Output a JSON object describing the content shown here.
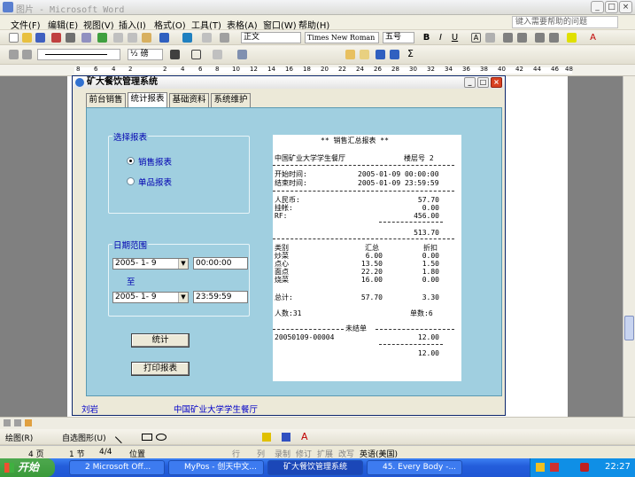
{
  "word": {
    "title": "图片 - Microsoft Word",
    "help_placeholder": "键入需要帮助的问题",
    "menu": [
      "文件(F)",
      "编辑(E)",
      "视图(V)",
      "插入(I)",
      "格式(O)",
      "工具(T)",
      "表格(A)",
      "窗口(W)",
      "帮助(H)"
    ],
    "style_value": "正文",
    "font_value": "Times New Roman",
    "size_value": "五号",
    "zoom_value": "½ 磅"
  },
  "ruler_numbers": [
    "8",
    "6",
    "4",
    "2",
    "",
    "2",
    "4",
    "6",
    "8",
    "10",
    "12",
    "14",
    "16",
    "18",
    "20",
    "22",
    "24",
    "26",
    "28",
    "30",
    "32",
    "34",
    "36",
    "38",
    "40",
    "42",
    "44",
    "46",
    "48"
  ],
  "app": {
    "title": "矿大餐饮管理系统",
    "tabs": [
      "前台销售",
      "统计报表",
      "基础资料",
      "系统维护"
    ],
    "report_group": "选择报表",
    "radio_sales": "销售报表",
    "radio_item": "单品报表",
    "date_group": "日期范围",
    "date_from": "2005- 1- 9",
    "time_from": "00:00:00",
    "to_label": "至",
    "date_to": "2005- 1- 9",
    "time_to": "23:59:59",
    "btn_stats": "统计",
    "btn_print": "打印报表",
    "footer_left": "刘岩",
    "footer_right": "中国矿业大学学生餐厅"
  },
  "report": {
    "title": "** 销售汇总报表 **",
    "restaurant": "中国矿业大学学生餐厅",
    "floor_label": "楼层号 2",
    "start_label": "开始时间:",
    "start_value": "2005-01-09 00:00:00",
    "end_label": "结束时间:",
    "end_value": "2005-01-09 23:59:59",
    "payments": [
      {
        "label": "人民币:",
        "value": "57.70"
      },
      {
        "label": "挂帐:",
        "value": "0.00"
      },
      {
        "label": "RF:",
        "value": "456.00"
      }
    ],
    "payment_total": "513.70",
    "col_cat": "类别",
    "col_sum": "汇总",
    "col_disc": "折扣",
    "rows": [
      {
        "cat": "炒菜",
        "sum": "6.00",
        "disc": "0.00"
      },
      {
        "cat": "点心",
        "sum": "13.50",
        "disc": "1.50"
      },
      {
        "cat": "面点",
        "sum": "22.20",
        "disc": "1.80"
      },
      {
        "cat": "烧菜",
        "sum": "16.00",
        "disc": "0.00"
      }
    ],
    "total_label": "总计:",
    "total_sum": "57.70",
    "total_disc": "3.30",
    "people": "人数:31",
    "orders": "单数:6",
    "unsettled_label": "未结单",
    "unsettled_id": "20050109-00004",
    "unsettled_amt": "12.00",
    "unsettled_total": "12.00"
  },
  "status": {
    "page": "4 页",
    "section": "1 节",
    "pages": "4/4",
    "pos": "位置",
    "row": "行",
    "col": "列",
    "rec": "录制",
    "rev": "修订",
    "ext": "扩展",
    "ovr": "改写",
    "lang": "英语(美国)"
  },
  "drawbar": {
    "draw": "绘图(R)",
    "autoshape": "自选图形(U)"
  },
  "taskbar": {
    "start": "开始",
    "tasks": [
      "2 Microsoft Off...",
      "MyPos - 创天中文...",
      "矿大餐饮管理系统",
      "45. Every Body -..."
    ],
    "clock": "22:27"
  }
}
